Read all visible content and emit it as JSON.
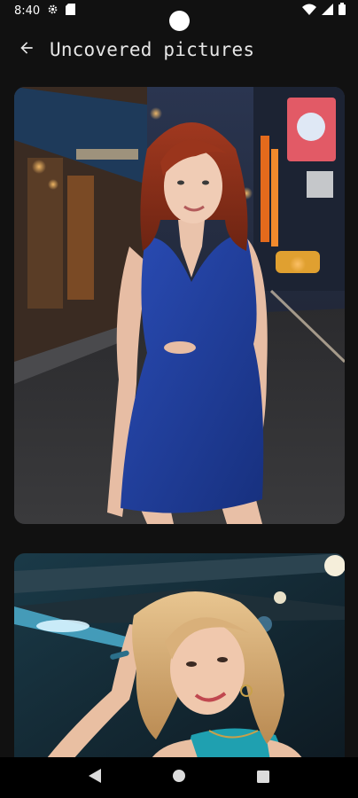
{
  "status_bar": {
    "time": "8:40",
    "left_icons": [
      "gear-icon",
      "sim-card-icon"
    ],
    "right_icons": [
      "wifi-icon",
      "signal-icon",
      "battery-icon"
    ]
  },
  "app_bar": {
    "back_icon": "arrow-back-icon",
    "title": "Uncovered pictures"
  },
  "gallery": {
    "items": [
      {
        "description_icon": "photo-woman-blue-dress-street-night"
      },
      {
        "description_icon": "photo-woman-blonde-neon-lights"
      }
    ]
  },
  "nav_bar": {
    "buttons": [
      "back-triangle-icon",
      "home-circle-icon",
      "recents-square-icon"
    ]
  },
  "colors": {
    "background": "#111111",
    "text": "#e6e6e6",
    "dress_blue": "#1f3f9e",
    "nav_bar": "#000000"
  }
}
